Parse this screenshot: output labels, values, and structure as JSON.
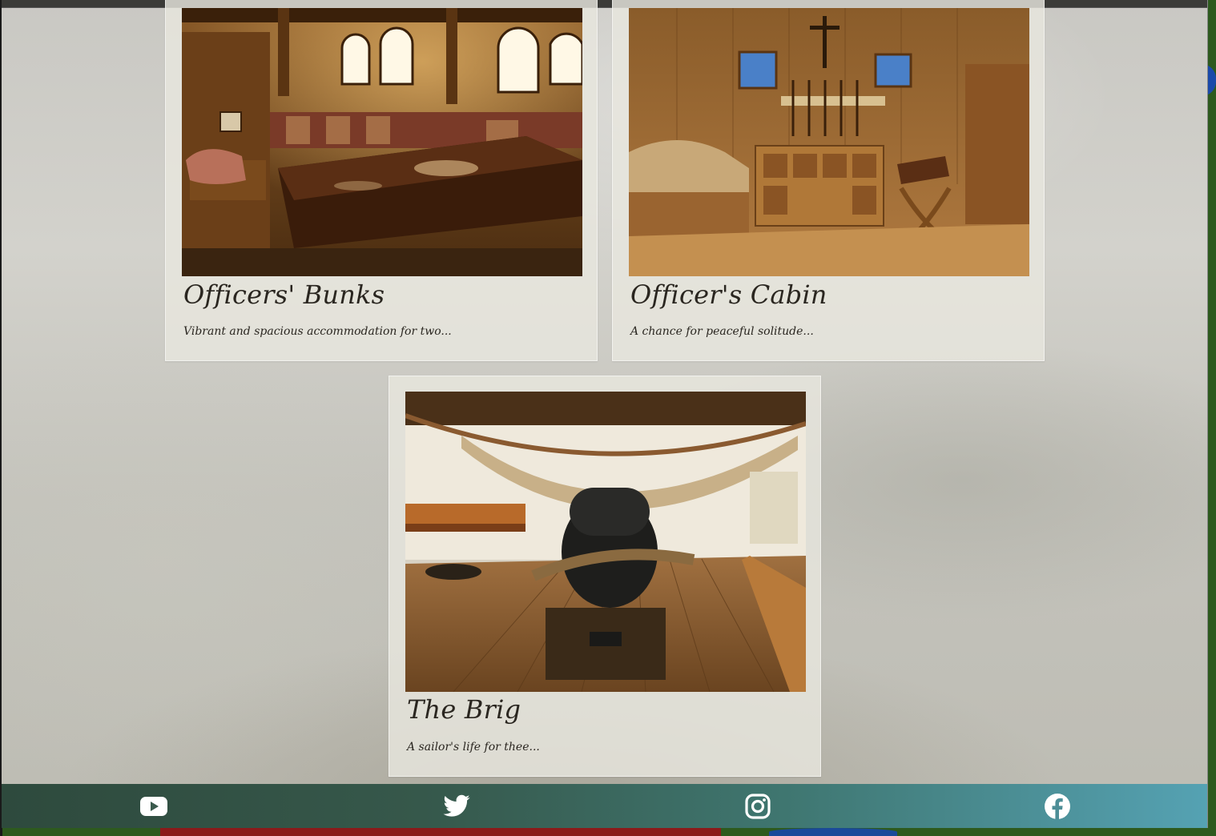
{
  "cards": [
    {
      "title": "Officers' Bunks",
      "description": "Vibrant and spacious accommodation for two...",
      "image_alt": "Wooden ship cabin with a long table, bunk and arched windows"
    },
    {
      "title": "Officer's Cabin",
      "description": "A chance for peaceful solitude...",
      "image_alt": "Wooden cabin with a bed, cupboard, crucifix and folding chair"
    },
    {
      "title": "The Brig",
      "description": "A sailor's life for thee...",
      "image_alt": "Gun deck with a cannon, ropes and hammocks"
    }
  ],
  "footer": {
    "links": [
      {
        "name": "YouTube",
        "icon": "youtube-icon"
      },
      {
        "name": "Twitter",
        "icon": "twitter-icon"
      },
      {
        "name": "Instagram",
        "icon": "instagram-icon"
      },
      {
        "name": "Facebook",
        "icon": "facebook-icon"
      }
    ]
  },
  "colors": {
    "footer_start": "#2e4a3d",
    "footer_end": "#55a2b3",
    "card_bg": "#e8e6de",
    "text": "#2a2620"
  }
}
